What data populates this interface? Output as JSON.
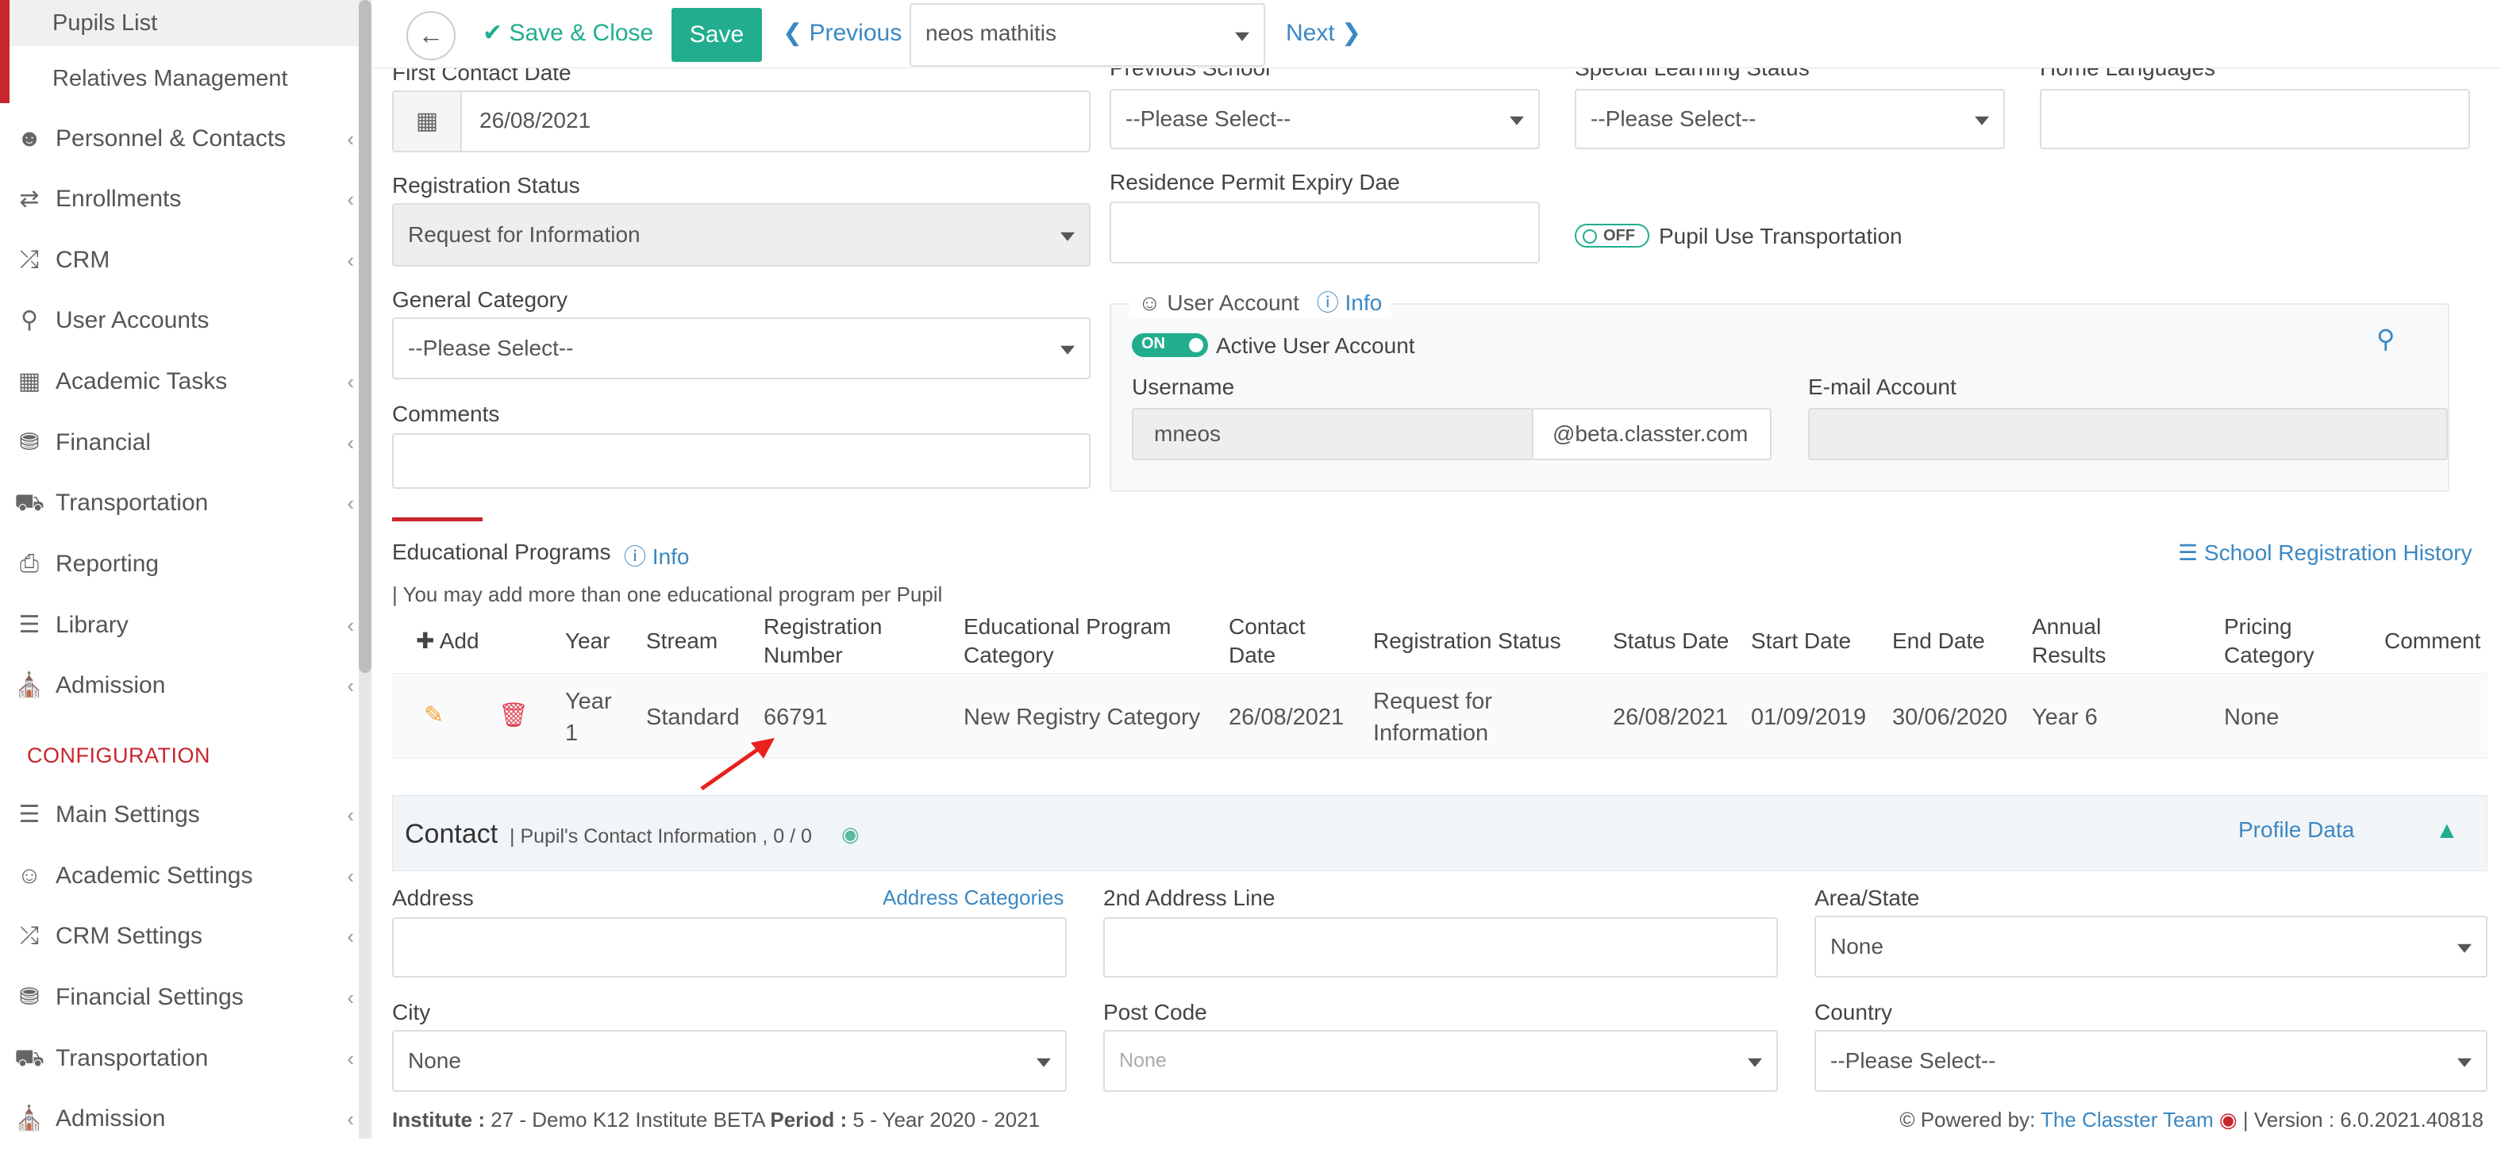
{
  "sidebar": {
    "sub_items": [
      "Pupils List",
      "Relatives Management"
    ],
    "items": [
      {
        "label": "Personnel & Contacts",
        "icon": "person-icon",
        "chev": true
      },
      {
        "label": "Enrollments",
        "icon": "transfer-icon",
        "chev": true
      },
      {
        "label": "CRM",
        "icon": "shuffle-icon",
        "chev": true
      },
      {
        "label": "User Accounts",
        "icon": "key-icon",
        "chev": false
      },
      {
        "label": "Academic Tasks",
        "icon": "grid-icon",
        "chev": true
      },
      {
        "label": "Financial",
        "icon": "coins-icon",
        "chev": true
      },
      {
        "label": "Transportation",
        "icon": "bus-icon",
        "chev": true
      },
      {
        "label": "Reporting",
        "icon": "printer-icon",
        "chev": false
      },
      {
        "label": "Library",
        "icon": "books-icon",
        "chev": true
      },
      {
        "label": "Admission",
        "icon": "institution-icon",
        "chev": true
      }
    ],
    "config_heading": "CONFIGURATION",
    "config_items": [
      {
        "label": "Main Settings",
        "icon": "sliders-icon"
      },
      {
        "label": "Academic Settings",
        "icon": "group-icon"
      },
      {
        "label": "CRM Settings",
        "icon": "shuffle-icon"
      },
      {
        "label": "Financial Settings",
        "icon": "coins-icon"
      },
      {
        "label": "Transportation",
        "icon": "bus-icon"
      },
      {
        "label": "Admission",
        "icon": "institution-icon"
      }
    ]
  },
  "toolbar": {
    "save_close": "Save & Close",
    "save": "Save",
    "previous": "Previous",
    "record_select": "neos mathitis",
    "next": "Next"
  },
  "form": {
    "first_contact_label": "First Contact Date",
    "first_contact_value": "26/08/2021",
    "previous_school_label": "Previous School",
    "previous_school_value": "--Please Select--",
    "special_learning_label": "Special Learning Status",
    "special_learning_value": "--Please Select--",
    "home_languages_label": "Home Languages",
    "registration_status_label": "Registration Status",
    "registration_status_value": "Request for Information",
    "residence_permit_label": "Residence Permit Expiry Dae",
    "transport_toggle": "OFF",
    "transport_label": "Pupil Use Transportation",
    "general_category_label": "General Category",
    "general_category_value": "--Please Select--",
    "comments_label": "Comments"
  },
  "user_account": {
    "title": "User Account",
    "info": "Info",
    "active_toggle": "ON",
    "active_label": "Active User Account",
    "username_label": "Username",
    "username_value": "mneos",
    "domain": "@beta.classter.com",
    "email_label": "E-mail Account"
  },
  "programs": {
    "title": "Educational Programs",
    "info": "Info",
    "history_link": "School Registration History",
    "note": "| You may add more than one educational program per Pupil",
    "add": "Add",
    "headers": [
      "Year",
      "Stream",
      "Registration Number",
      "Educational Program Category",
      "Contact Date",
      "Registration Status",
      "Status Date",
      "Start Date",
      "End Date",
      "Annual Results Model",
      "Pricing Category",
      "Comment"
    ],
    "rows": [
      {
        "year": "Year 1",
        "stream": "Standard",
        "reg_no": "66791",
        "category": "New Registry Category",
        "contact_date": "26/08/2021",
        "status": "Request for Information",
        "status_date": "26/08/2021",
        "start": "01/09/2019",
        "end": "30/06/2020",
        "model": "Year 6",
        "pricing": "None",
        "comment": ""
      }
    ]
  },
  "contact": {
    "title": "Contact",
    "subtitle": "| Pupil's Contact Information , 0 / 0",
    "profile_link": "Profile Data",
    "address_label": "Address",
    "address_categories": "Address Categories",
    "address2_label": "2nd Address Line",
    "area_label": "Area/State",
    "area_value": "None",
    "city_label": "City",
    "city_value": "None",
    "postcode_label": "Post Code",
    "postcode_value": "None",
    "country_label": "Country",
    "country_value": "--Please Select--"
  },
  "footer": {
    "institute_label": "Institute :",
    "institute_value": "27 - Demo K12 Institute BETA",
    "period_label": "Period :",
    "period_value": "5 - Year 2020 - 2021",
    "powered": "Powered by:",
    "team": "The Classter Team",
    "version": "| Version : 6.0.2021.40818"
  },
  "colors": {
    "accent": "#22ae8e",
    "link": "#3b88c3",
    "brand_red": "#c9252c"
  }
}
